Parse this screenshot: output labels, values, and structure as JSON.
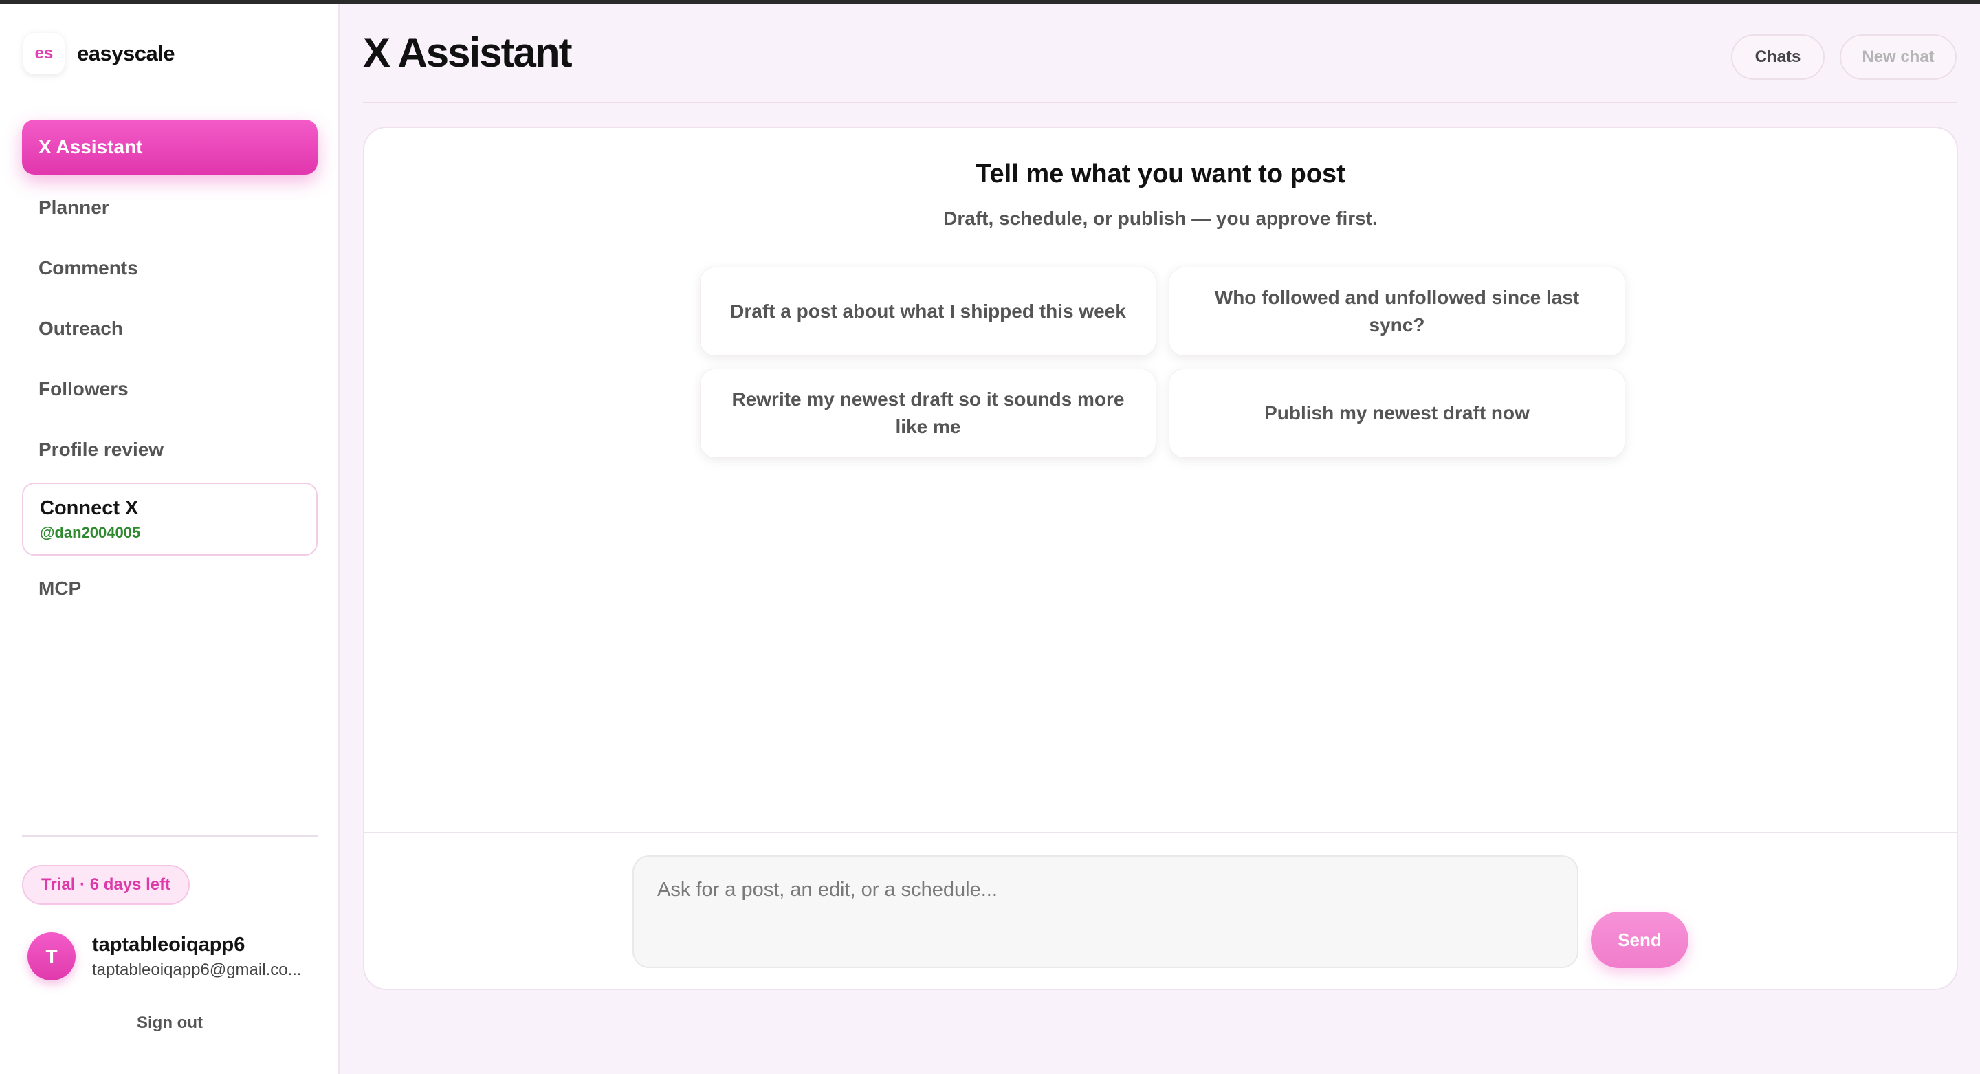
{
  "brand": {
    "badge": "es",
    "name": "easyscale"
  },
  "sidebar": {
    "items": [
      {
        "label": "X Assistant",
        "active": true
      },
      {
        "label": "Planner"
      },
      {
        "label": "Comments"
      },
      {
        "label": "Outreach"
      },
      {
        "label": "Followers"
      },
      {
        "label": "Profile review"
      }
    ],
    "connect": {
      "label": "Connect X",
      "handle": "@dan2004005"
    },
    "mcp": {
      "label": "MCP"
    }
  },
  "trial": {
    "label": "Trial · 6 days left"
  },
  "user": {
    "initial": "T",
    "name": "taptableoiqapp6",
    "email": "taptableoiqapp6@gmail.co..."
  },
  "signout": {
    "label": "Sign out"
  },
  "header": {
    "title": "X Assistant",
    "chats_label": "Chats",
    "new_chat_label": "New chat"
  },
  "main": {
    "prompt_title": "Tell me what you want to post",
    "prompt_subtitle": "Draft, schedule, or publish — you approve first.",
    "suggestions": [
      "Draft a post about what I shipped this week",
      "Who followed and unfollowed since last sync?",
      "Rewrite my newest draft so it sounds more like me",
      "Publish my newest draft now"
    ],
    "input_placeholder": "Ask for a post, an edit, or a schedule...",
    "send_label": "Send"
  },
  "colors": {
    "accent": "#e136ad",
    "accent_light": "#f07dcb",
    "handle_green": "#2f8a2f",
    "page_bg": "#faf2fb"
  }
}
